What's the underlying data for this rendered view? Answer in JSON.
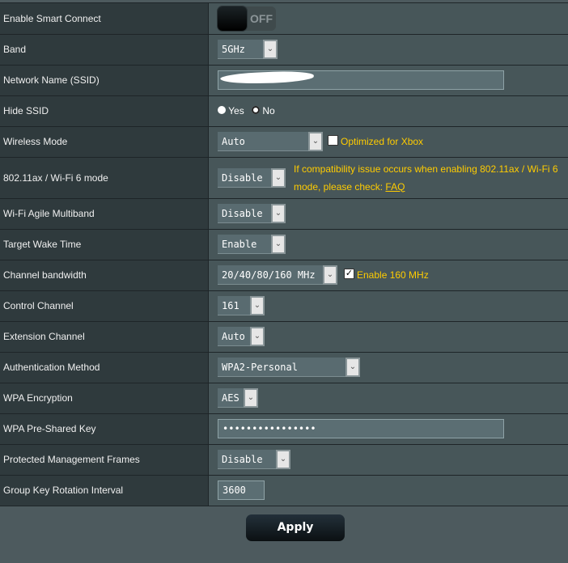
{
  "rows": {
    "smart_connect": {
      "label": "Enable Smart Connect",
      "toggle": "OFF"
    },
    "band": {
      "label": "Band",
      "value": "5GHz"
    },
    "ssid": {
      "label": "Network Name (SSID)",
      "value": "[redacted]"
    },
    "hide_ssid": {
      "label": "Hide SSID",
      "yes": "Yes",
      "no": "No",
      "selected": "No"
    },
    "wireless_mode": {
      "label": "Wireless Mode",
      "value": "Auto",
      "checkbox_label": "Optimized for Xbox",
      "checked": false
    },
    "ax_mode": {
      "label": "802.11ax / Wi-Fi 6 mode",
      "value": "Disable",
      "note_line1": "If compatibility issue occurs when enabling 802.11ax / Wi-Fi 6",
      "note_line2": "mode, please check: ",
      "faq_link": "FAQ"
    },
    "agile_multiband": {
      "label": "Wi-Fi Agile Multiband",
      "value": "Disable"
    },
    "target_wake_time": {
      "label": "Target Wake Time",
      "value": "Enable"
    },
    "channel_bandwidth": {
      "label": "Channel bandwidth",
      "value": "20/40/80/160 MHz",
      "checkbox_label": "Enable 160 MHz",
      "checked": true
    },
    "control_channel": {
      "label": "Control Channel",
      "value": "161"
    },
    "extension_channel": {
      "label": "Extension Channel",
      "value": "Auto"
    },
    "auth_method": {
      "label": "Authentication Method",
      "value": "WPA2-Personal"
    },
    "wpa_encryption": {
      "label": "WPA Encryption",
      "value": "AES"
    },
    "psk": {
      "label": "WPA Pre-Shared Key",
      "value": "••••••••••••••••"
    },
    "pmf": {
      "label": "Protected Management Frames",
      "value": "Disable"
    },
    "group_key": {
      "label": "Group Key Rotation Interval",
      "value": "3600"
    }
  },
  "apply_label": "Apply",
  "colors": {
    "label_bg": "#2f3a3d",
    "field_bg": "#475659",
    "accent_yellow": "#ffcc00"
  }
}
